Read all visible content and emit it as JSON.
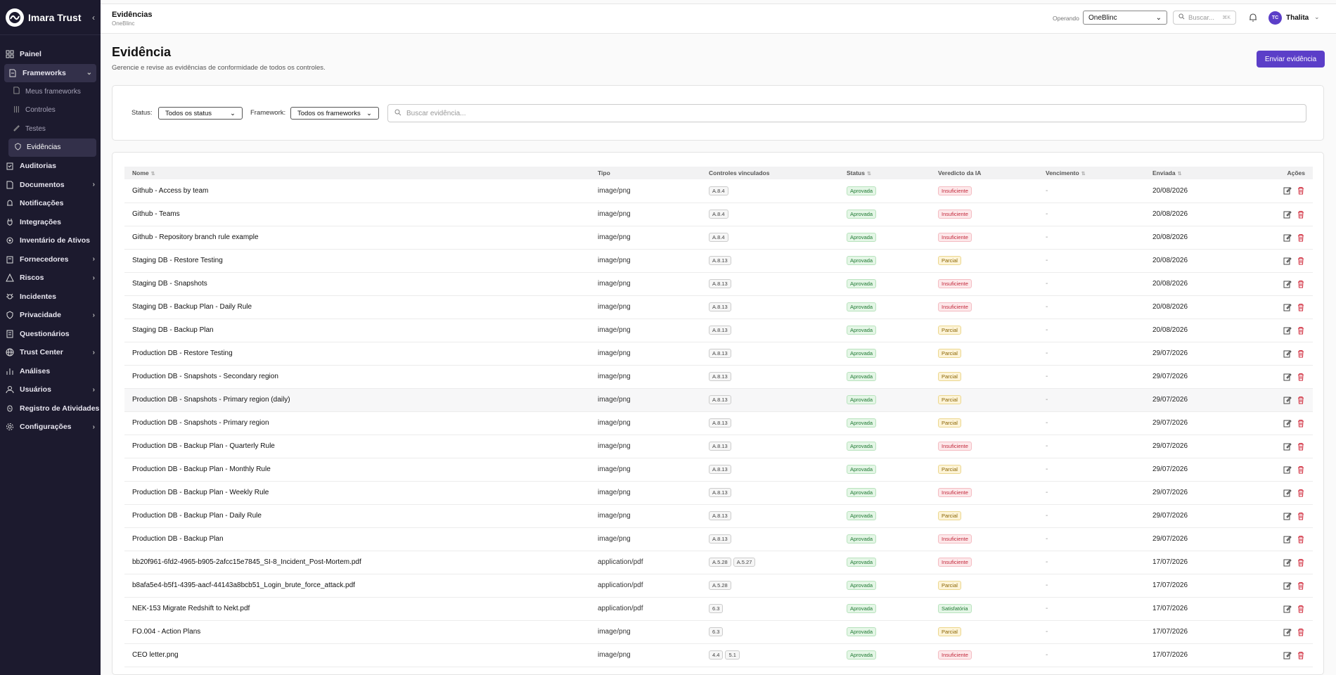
{
  "brand": {
    "name": "Imara Trust"
  },
  "sidebar": {
    "items": [
      {
        "label": "Painel",
        "icon": "dashboard-icon"
      },
      {
        "label": "Frameworks",
        "icon": "document-icon",
        "expanded": true
      },
      {
        "label": "Meus frameworks",
        "icon": "doc-icon",
        "sub": true
      },
      {
        "label": "Controles",
        "icon": "sliders-icon",
        "sub": true
      },
      {
        "label": "Testes",
        "icon": "pencil-icon",
        "sub": true
      },
      {
        "label": "Evidências",
        "icon": "shield-icon",
        "sub": true,
        "active": true
      },
      {
        "label": "Auditorias",
        "icon": "clipboard-icon"
      },
      {
        "label": "Documentos",
        "icon": "file-icon",
        "chevron": true
      },
      {
        "label": "Notificações",
        "icon": "bell-icon"
      },
      {
        "label": "Integrações",
        "icon": "plug-icon"
      },
      {
        "label": "Inventário de Ativos",
        "icon": "assets-icon"
      },
      {
        "label": "Fornecedores",
        "icon": "building-icon",
        "chevron": true
      },
      {
        "label": "Riscos",
        "icon": "warning-icon",
        "chevron": true
      },
      {
        "label": "Incidentes",
        "icon": "bug-icon"
      },
      {
        "label": "Privacidade",
        "icon": "shield-icon",
        "chevron": true
      },
      {
        "label": "Questionários",
        "icon": "list-icon"
      },
      {
        "label": "Trust Center",
        "icon": "globe-icon",
        "chevron": true
      },
      {
        "label": "Análises",
        "icon": "chart-icon"
      },
      {
        "label": "Usuários",
        "icon": "users-icon",
        "chevron": true
      },
      {
        "label": "Registro de Atividades",
        "icon": "activity-icon"
      },
      {
        "label": "Configurações",
        "icon": "gear-icon",
        "chevron": true
      }
    ]
  },
  "topbar": {
    "title": "Evidências",
    "subtitle": "OneBlinc",
    "operando_label": "Operando",
    "operando_value": "OneBlinc",
    "search_placeholder": "Buscar...",
    "search_kbd": "⌘K",
    "user_initials": "TC",
    "user_name": "Thalita"
  },
  "page": {
    "title": "Evidência",
    "description": "Gerencie e revise as evidências de conformidade de todos os controles.",
    "primary_button": "Enviar evidência"
  },
  "filters": {
    "status_label": "Status:",
    "status_value": "Todos os status",
    "framework_label": "Framework:",
    "framework_value": "Todos os frameworks",
    "search_placeholder": "Buscar evidência..."
  },
  "table": {
    "headers": [
      "Nome",
      "Tipo",
      "Controles vinculados",
      "Status",
      "Veredicto da IA",
      "Vencimento",
      "Enviada",
      "Ações"
    ],
    "rows": [
      {
        "name": "Github - Access by team",
        "type": "image/png",
        "controls": [
          "A.8.4"
        ],
        "status": "Aprovada",
        "verdict": "Insuficiente",
        "due": "-",
        "sent": "20/08/2026"
      },
      {
        "name": "Github - Teams",
        "type": "image/png",
        "controls": [
          "A.8.4"
        ],
        "status": "Aprovada",
        "verdict": "Insuficiente",
        "due": "-",
        "sent": "20/08/2026"
      },
      {
        "name": "Github - Repository branch rule example",
        "type": "image/png",
        "controls": [
          "A.8.4"
        ],
        "status": "Aprovada",
        "verdict": "Insuficiente",
        "due": "-",
        "sent": "20/08/2026"
      },
      {
        "name": "Staging DB - Restore Testing",
        "type": "image/png",
        "controls": [
          "A.8.13"
        ],
        "status": "Aprovada",
        "verdict": "Parcial",
        "due": "-",
        "sent": "20/08/2026"
      },
      {
        "name": "Staging DB - Snapshots",
        "type": "image/png",
        "controls": [
          "A.8.13"
        ],
        "status": "Aprovada",
        "verdict": "Insuficiente",
        "due": "-",
        "sent": "20/08/2026"
      },
      {
        "name": "Staging DB - Backup Plan - Daily Rule",
        "type": "image/png",
        "controls": [
          "A.8.13"
        ],
        "status": "Aprovada",
        "verdict": "Insuficiente",
        "due": "-",
        "sent": "20/08/2026"
      },
      {
        "name": "Staging DB - Backup Plan",
        "type": "image/png",
        "controls": [
          "A.8.13"
        ],
        "status": "Aprovada",
        "verdict": "Parcial",
        "due": "-",
        "sent": "20/08/2026"
      },
      {
        "name": "Production DB - Restore Testing",
        "type": "image/png",
        "controls": [
          "A.8.13"
        ],
        "status": "Aprovada",
        "verdict": "Parcial",
        "due": "-",
        "sent": "29/07/2026"
      },
      {
        "name": "Production DB - Snapshots - Secondary region",
        "type": "image/png",
        "controls": [
          "A.8.13"
        ],
        "status": "Aprovada",
        "verdict": "Parcial",
        "due": "-",
        "sent": "29/07/2026"
      },
      {
        "name": "Production DB - Snapshots - Primary region (daily)",
        "type": "image/png",
        "controls": [
          "A.8.13"
        ],
        "status": "Aprovada",
        "verdict": "Parcial",
        "due": "-",
        "sent": "29/07/2026",
        "highlight": true
      },
      {
        "name": "Production DB - Snapshots - Primary region",
        "type": "image/png",
        "controls": [
          "A.8.13"
        ],
        "status": "Aprovada",
        "verdict": "Parcial",
        "due": "-",
        "sent": "29/07/2026"
      },
      {
        "name": "Production DB - Backup Plan - Quarterly Rule",
        "type": "image/png",
        "controls": [
          "A.8.13"
        ],
        "status": "Aprovada",
        "verdict": "Insuficiente",
        "due": "-",
        "sent": "29/07/2026"
      },
      {
        "name": "Production DB - Backup Plan - Monthly Rule",
        "type": "image/png",
        "controls": [
          "A.8.13"
        ],
        "status": "Aprovada",
        "verdict": "Parcial",
        "due": "-",
        "sent": "29/07/2026"
      },
      {
        "name": "Production DB - Backup Plan - Weekly Rule",
        "type": "image/png",
        "controls": [
          "A.8.13"
        ],
        "status": "Aprovada",
        "verdict": "Insuficiente",
        "due": "-",
        "sent": "29/07/2026"
      },
      {
        "name": "Production DB - Backup Plan - Daily Rule",
        "type": "image/png",
        "controls": [
          "A.8.13"
        ],
        "status": "Aprovada",
        "verdict": "Parcial",
        "due": "-",
        "sent": "29/07/2026"
      },
      {
        "name": "Production DB - Backup Plan",
        "type": "image/png",
        "controls": [
          "A.8.13"
        ],
        "status": "Aprovada",
        "verdict": "Insuficiente",
        "due": "-",
        "sent": "29/07/2026"
      },
      {
        "name": "bb20f961-6fd2-4965-b905-2afcc15e7845_SI-8_Incident_Post-Mortem.pdf",
        "type": "application/pdf",
        "controls": [
          "A.5.28",
          "A.5.27"
        ],
        "status": "Aprovada",
        "verdict": "Insuficiente",
        "due": "-",
        "sent": "17/07/2026"
      },
      {
        "name": "b8afa5e4-b5f1-4395-aacf-44143a8bcb51_Login_brute_force_attack.pdf",
        "type": "application/pdf",
        "controls": [
          "A.5.28"
        ],
        "status": "Aprovada",
        "verdict": "Parcial",
        "due": "-",
        "sent": "17/07/2026"
      },
      {
        "name": "NEK-153 Migrate Redshift to Nekt.pdf",
        "type": "application/pdf",
        "controls": [
          "6.3"
        ],
        "status": "Aprovada",
        "verdict": "Satisfatória",
        "due": "-",
        "sent": "17/07/2026"
      },
      {
        "name": "FO.004 - Action Plans",
        "type": "image/png",
        "controls": [
          "6.3"
        ],
        "status": "Aprovada",
        "verdict": "Parcial",
        "due": "-",
        "sent": "17/07/2026"
      },
      {
        "name": "CEO letter.png",
        "type": "image/png",
        "controls": [
          "4.4",
          "5.1"
        ],
        "status": "Aprovada",
        "verdict": "Insuficiente",
        "due": "-",
        "sent": "17/07/2026"
      }
    ]
  },
  "colors": {
    "accent": "#5b3ec8",
    "sidebar_bg": "#1c1a2e"
  }
}
